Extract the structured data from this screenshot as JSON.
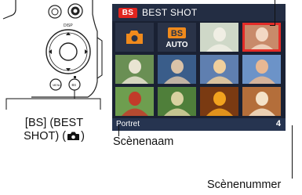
{
  "screen": {
    "badge": "BS",
    "title": "BEST SHOT",
    "cells": [
      {
        "name": "camera-icon-cell",
        "kind": "icon-camera"
      },
      {
        "name": "bs-auto-cell",
        "kind": "icon-bsauto",
        "badge": "BS",
        "text": "AUTO"
      },
      {
        "name": "scene-cell-3",
        "kind": "pic",
        "bg": "#cfd8c8",
        "fg": "#f0eee4"
      },
      {
        "name": "scene-cell-portrait",
        "kind": "pic",
        "bg": "#c88a6a",
        "fg": "#f3d8c4",
        "selected": true
      },
      {
        "name": "scene-cell-5",
        "kind": "pic",
        "bg": "#6a8f54",
        "fg": "#e9e4d2"
      },
      {
        "name": "scene-cell-6",
        "kind": "pic",
        "bg": "#3a5d8a",
        "fg": "#d9c2a8"
      },
      {
        "name": "scene-cell-7",
        "kind": "pic",
        "bg": "#5f7fb0",
        "fg": "#f0cf9c"
      },
      {
        "name": "scene-cell-8",
        "kind": "pic",
        "bg": "#6c93c8",
        "fg": "#e8b893"
      },
      {
        "name": "scene-cell-9",
        "kind": "pic",
        "bg": "#6e9e4f",
        "fg": "#c23b2a"
      },
      {
        "name": "scene-cell-10",
        "kind": "pic",
        "bg": "#4f7f3a",
        "fg": "#d8d1a0"
      },
      {
        "name": "scene-cell-11",
        "kind": "pic",
        "bg": "#7a3a12",
        "fg": "#f2a21e"
      },
      {
        "name": "scene-cell-12",
        "kind": "pic",
        "bg": "#b46e3a",
        "fg": "#f4e2c8"
      },
      {
        "name": "scene-cell-13",
        "kind": "pic",
        "bg": "#7da35a",
        "fg": "#e9e8de"
      },
      {
        "name": "scene-cell-14",
        "kind": "pic",
        "bg": "#5e8a2e",
        "fg": "#f5df3a"
      },
      {
        "name": "scene-cell-15",
        "kind": "pic",
        "bg": "#6e9c48",
        "fg": "#3c5e2a"
      },
      {
        "name": "scene-cell-16",
        "kind": "pic",
        "bg": "#5c7690",
        "fg": "#c4d2e2"
      }
    ],
    "scene_name": "Portret",
    "scene_number": "4"
  },
  "callouts": {
    "bs_button_line1": "[BS] (BEST",
    "bs_button_line2": "SHOT) (",
    "bs_button_line2_end": ")",
    "scene_name_label": "Scènenaam",
    "scene_number_label": "Scènenummer"
  },
  "camera": {
    "button_labels": [
      "DISP",
      "MENU",
      "BS"
    ]
  },
  "colors": {
    "screen_bg": "#1a2133",
    "header_bg": "#232d43",
    "badge_red": "#e2251f",
    "selection_red": "#e32c28",
    "icon_orange": "#f08a1c"
  }
}
